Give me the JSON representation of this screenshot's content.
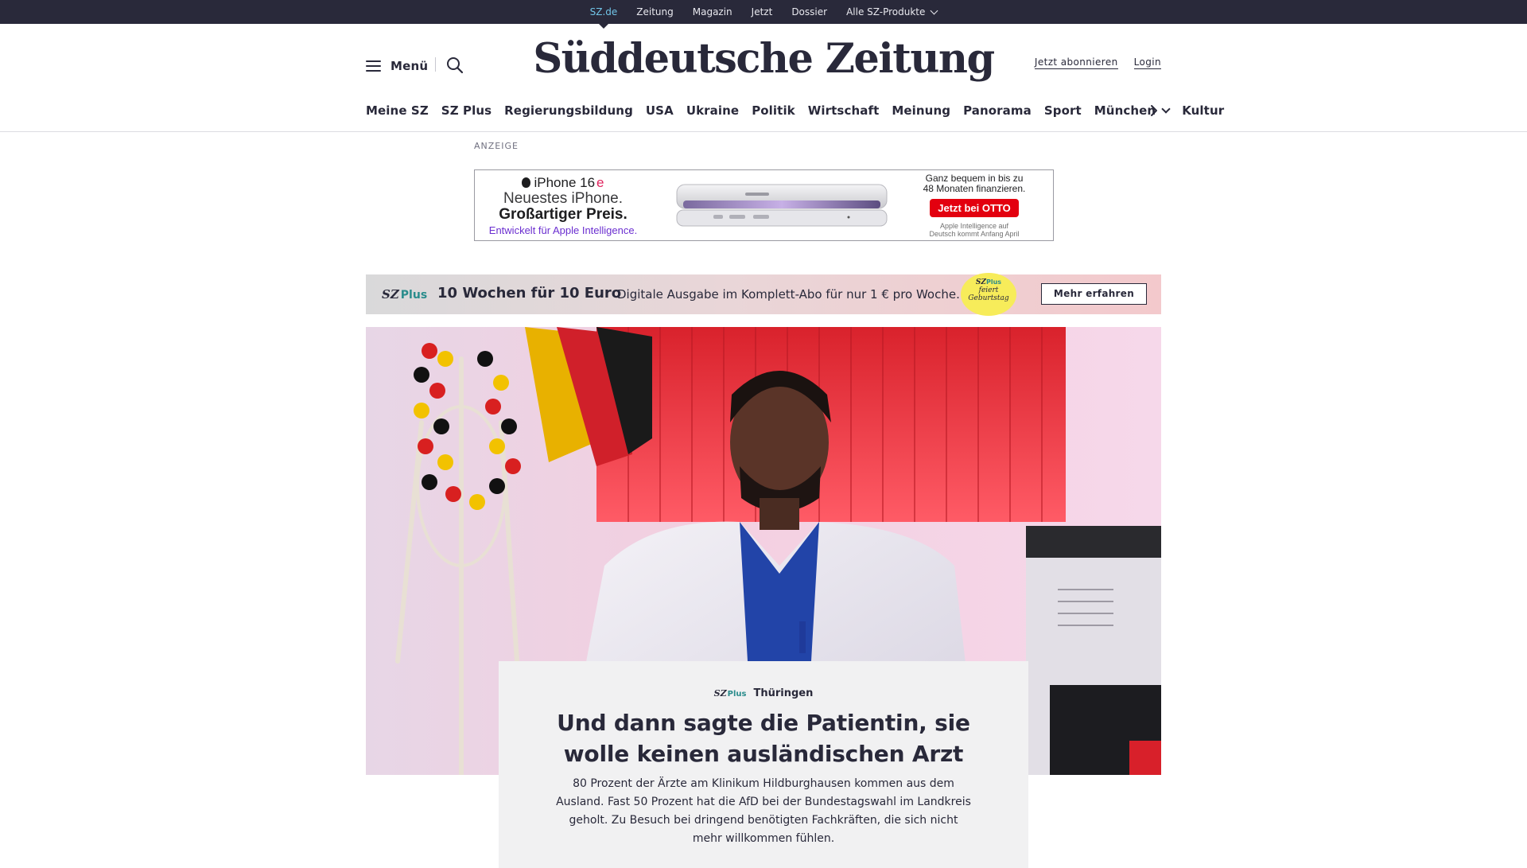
{
  "topbar": {
    "links": [
      {
        "label": "SZ.de",
        "active": true
      },
      {
        "label": "Zeitung"
      },
      {
        "label": "Magazin"
      },
      {
        "label": "Jetzt"
      },
      {
        "label": "Dossier"
      },
      {
        "label": "Alle SZ-Produkte",
        "dropdown": true
      }
    ],
    "background": "#29293a",
    "active_color": "#71c5e8"
  },
  "header": {
    "menu_label": "Menü",
    "logo_text": "Süddeutsche Zeitung",
    "subscribe_label": "Jetzt abonnieren",
    "login_label": "Login"
  },
  "nav": {
    "items": [
      {
        "label": "Meine SZ"
      },
      {
        "label": "SZ Plus"
      },
      {
        "label": "Regierungsbildung"
      },
      {
        "label": "USA"
      },
      {
        "label": "Ukraine"
      },
      {
        "label": "Politik"
      },
      {
        "label": "Wirtschaft"
      },
      {
        "label": "Meinung"
      },
      {
        "label": "Panorama"
      },
      {
        "label": "Sport"
      },
      {
        "label": "München",
        "dropdown": true
      },
      {
        "label": "Kultur"
      }
    ],
    "next_icon": "chevron-right-icon"
  },
  "ad": {
    "label": "ANZEIGE",
    "product": "iPhone 16",
    "product_suffix": "e",
    "line1": "Neuestes iPhone.",
    "line2": "Großartiger Preis.",
    "line3": "Entwickelt für Apple Intelligence.",
    "right_text1": "Ganz bequem in bis zu",
    "right_text2": "48 Monaten finanzieren.",
    "cta": "Jetzt bei OTTO",
    "disclaimer1": "Apple Intelligence auf",
    "disclaimer2": "Deutsch kommt Anfang April"
  },
  "promo": {
    "brand": "SZ",
    "brand_plus": "Plus",
    "title": "10 Wochen für 10 Euro",
    "text": "Digitale Ausgabe im Komplett-Abo für nur 1 € pro Woche.",
    "badge_brand": "SZ",
    "badge_plus": "Plus",
    "badge_line1": "feiert",
    "badge_line2": "Geburtstag",
    "button": "Mehr erfahren",
    "badge_color": "#f7ec5a"
  },
  "article": {
    "brand": "SZ",
    "brand_plus": "Plus",
    "kicker": "Thüringen",
    "title": "Und dann sagte die Patientin, sie wolle keinen ausländischen Arzt",
    "teaser": "80 Prozent der Ärzte am Klinikum Hildburghausen kommen aus dem Ausland. Fast 50 Prozent hat die AfD bei der Bundestagswahl im Landkreis geholt. Zu Besuch bei dringend benötigten Fachkräften, die sich nicht mehr willkommen fühlen."
  }
}
